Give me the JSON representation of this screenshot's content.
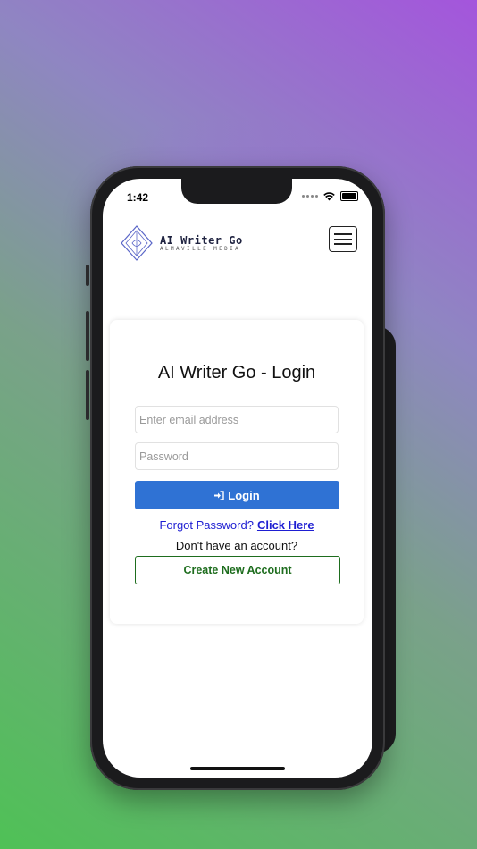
{
  "status_bar": {
    "time": "1:42"
  },
  "header": {
    "logo_title": "AI Writer Go",
    "logo_subtitle": "ALMAVILLE MEDIA"
  },
  "login": {
    "title": "AI Writer Go - Login",
    "email_placeholder": "Enter email address",
    "password_placeholder": "Password",
    "login_label": "Login",
    "forgot_text": "Forgot Password?",
    "forgot_link": "Click Here",
    "no_account_text": "Don't have an account?",
    "create_label": "Create New Account"
  },
  "colors": {
    "primary": "#2f72d4",
    "success": "#1e6d1e",
    "link": "#1e1ed2"
  },
  "icons": [
    "wifi-icon",
    "battery-icon",
    "menu-icon",
    "sign-in-icon",
    "logo-diamond-icon"
  ]
}
